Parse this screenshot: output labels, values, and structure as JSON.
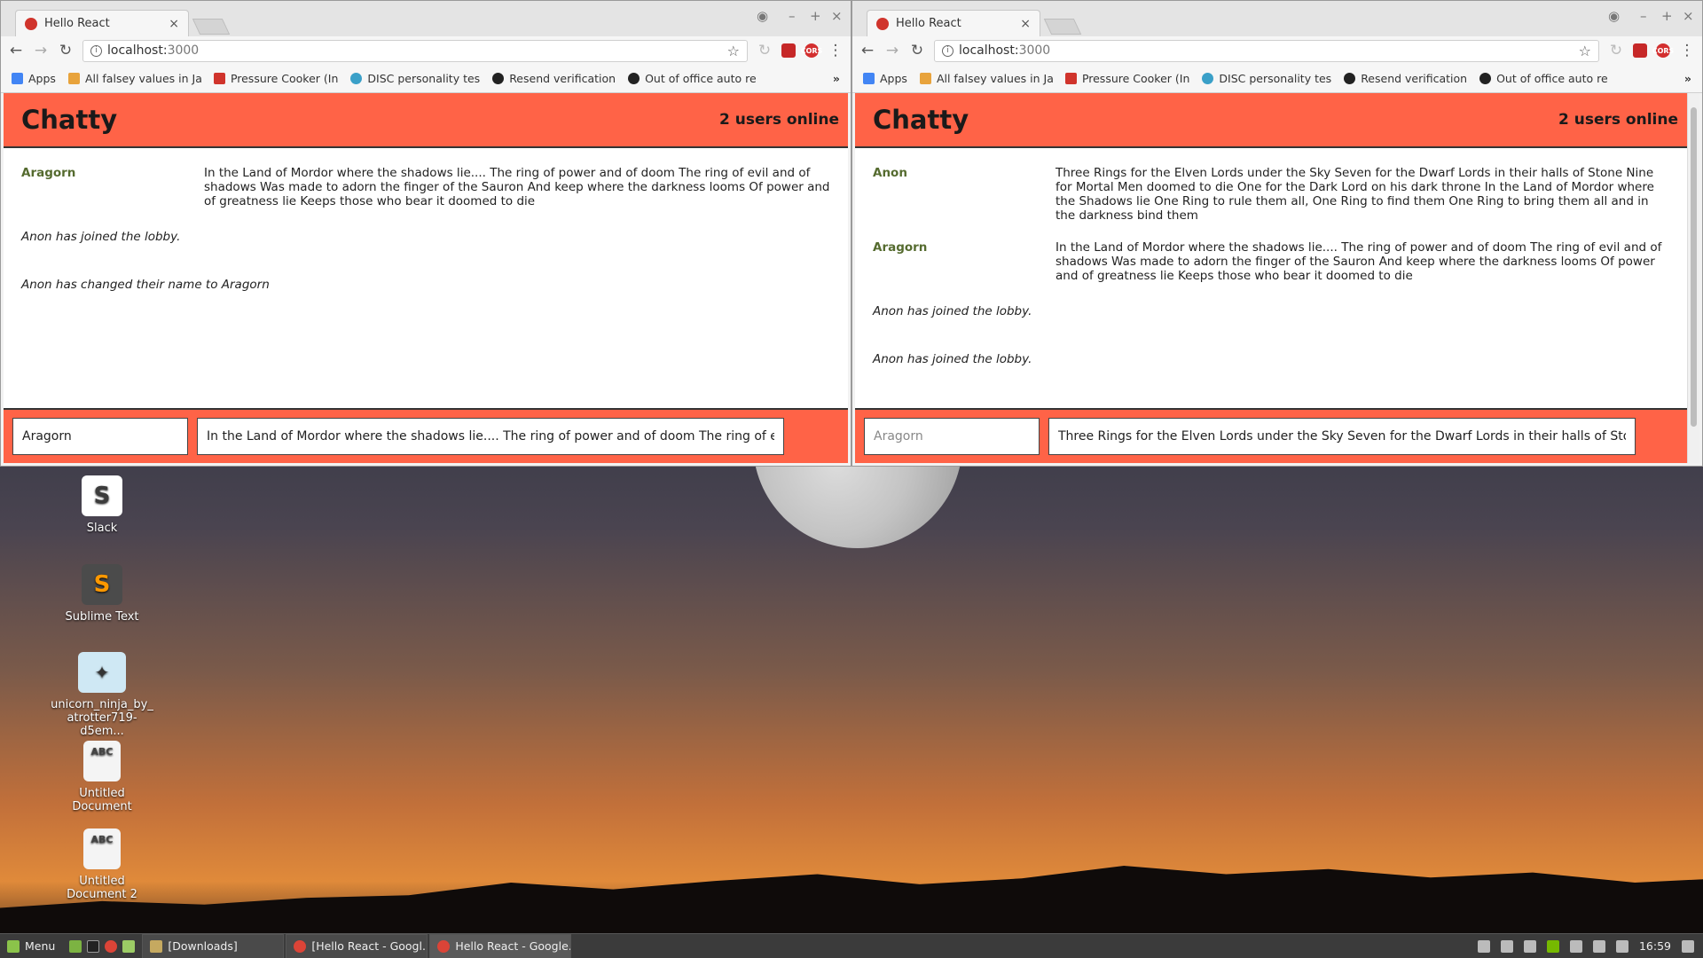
{
  "desktop": {
    "icons": [
      {
        "label": "Slack",
        "icon": "slack-icon",
        "color": "#ffffff"
      },
      {
        "label": "Sublime Text",
        "icon": "sublime-text-icon",
        "color": "#4b4b4b"
      },
      {
        "label": "unicorn_ninja_by_ atrotter719-d5em...",
        "icon": "image-file-icon",
        "color": "#cfe8f4"
      },
      {
        "label": "Untitled Document",
        "icon": "document-icon",
        "color": "#f4f4f4"
      },
      {
        "label": "Untitled Document 2",
        "icon": "document-icon",
        "color": "#f4f4f4"
      }
    ]
  },
  "browser": {
    "tab_title": "Hello React",
    "tab_close": "×",
    "url_host": "localhost:",
    "url_port": "3000",
    "bookmarks": [
      {
        "label": "Apps",
        "color": "#4285f4"
      },
      {
        "label": "All falsey values in Ja",
        "color": "#e8a33c"
      },
      {
        "label": "Pressure Cooker (In",
        "color": "#d0342c"
      },
      {
        "label": "DISC personality tes",
        "color": "#3aa0c8"
      },
      {
        "label": "Resend verification",
        "color": "#222222"
      },
      {
        "label": "Out of office auto re",
        "color": "#222222"
      }
    ],
    "bookmarks_more": "»",
    "ext_cors": "CORS"
  },
  "left_window": {
    "brand": "Chatty",
    "online": "2 users online",
    "messages": [
      {
        "user": "Aragorn",
        "content": "In the Land of Mordor where the shadows lie.... The ring of power and of doom The ring of evil and of shadows Was made to adorn the finger of the Sauron And keep where the darkness looms Of power and of greatness lie Keeps those who bear it doomed to die"
      }
    ],
    "system": [
      "Anon has joined the lobby.",
      "Anon has changed their name to Aragorn"
    ],
    "username_value": "Aragorn",
    "message_value": "In the Land of Mordor where the shadows lie.... The ring of power and of doom The ring of evil and"
  },
  "right_window": {
    "brand": "Chatty",
    "online": "2 users online",
    "messages": [
      {
        "user": "Anon",
        "content": "Three Rings for the Elven Lords under the Sky Seven for the Dwarf Lords in their halls of Stone Nine for Mortal Men doomed to die One for the Dark Lord on his dark throne In the Land of Mordor where the Shadows lie One Ring to rule them all, One Ring to find them One Ring to bring them all and in the darkness bind them"
      },
      {
        "user": "Aragorn",
        "content": "In the Land of Mordor where the shadows lie.... The ring of power and of doom The ring of evil and of shadows Was made to adorn the finger of the Sauron And keep where the darkness looms Of power and of greatness lie Keeps those who bear it doomed to die"
      }
    ],
    "system": [
      "Anon has joined the lobby.",
      "Anon has joined the lobby."
    ],
    "username_placeholder": "Aragorn",
    "message_value": "Three Rings for the Elven Lords under the Sky Seven for the Dwarf Lords in their halls of Stone N"
  },
  "taskbar": {
    "menu": "Menu",
    "tasks": [
      "[Downloads]",
      "[Hello React - Googl...",
      "Hello React - Google..."
    ],
    "clock": "16:59"
  }
}
